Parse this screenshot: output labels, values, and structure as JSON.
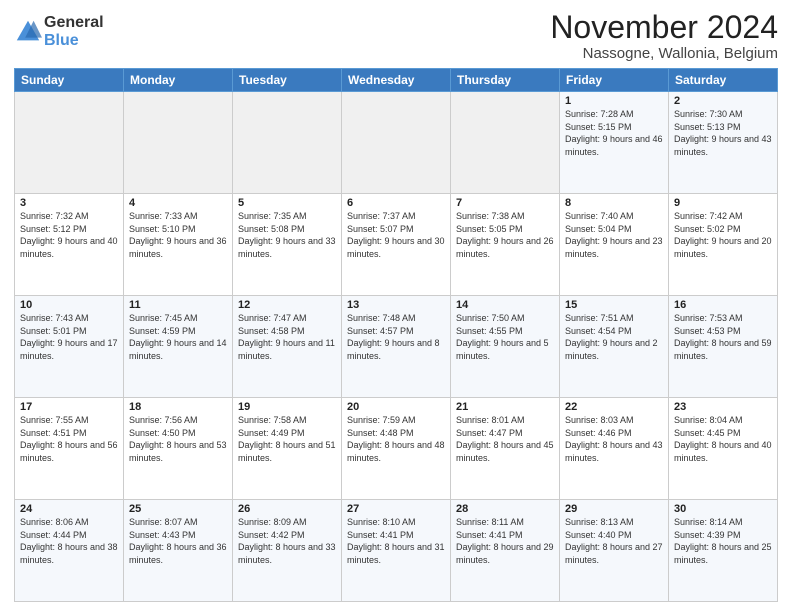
{
  "logo": {
    "general": "General",
    "blue": "Blue"
  },
  "header": {
    "month": "November 2024",
    "location": "Nassogne, Wallonia, Belgium"
  },
  "days_of_week": [
    "Sunday",
    "Monday",
    "Tuesday",
    "Wednesday",
    "Thursday",
    "Friday",
    "Saturday"
  ],
  "weeks": [
    [
      {
        "day": "",
        "info": ""
      },
      {
        "day": "",
        "info": ""
      },
      {
        "day": "",
        "info": ""
      },
      {
        "day": "",
        "info": ""
      },
      {
        "day": "",
        "info": ""
      },
      {
        "day": "1",
        "info": "Sunrise: 7:28 AM\nSunset: 5:15 PM\nDaylight: 9 hours and 46 minutes."
      },
      {
        "day": "2",
        "info": "Sunrise: 7:30 AM\nSunset: 5:13 PM\nDaylight: 9 hours and 43 minutes."
      }
    ],
    [
      {
        "day": "3",
        "info": "Sunrise: 7:32 AM\nSunset: 5:12 PM\nDaylight: 9 hours and 40 minutes."
      },
      {
        "day": "4",
        "info": "Sunrise: 7:33 AM\nSunset: 5:10 PM\nDaylight: 9 hours and 36 minutes."
      },
      {
        "day": "5",
        "info": "Sunrise: 7:35 AM\nSunset: 5:08 PM\nDaylight: 9 hours and 33 minutes."
      },
      {
        "day": "6",
        "info": "Sunrise: 7:37 AM\nSunset: 5:07 PM\nDaylight: 9 hours and 30 minutes."
      },
      {
        "day": "7",
        "info": "Sunrise: 7:38 AM\nSunset: 5:05 PM\nDaylight: 9 hours and 26 minutes."
      },
      {
        "day": "8",
        "info": "Sunrise: 7:40 AM\nSunset: 5:04 PM\nDaylight: 9 hours and 23 minutes."
      },
      {
        "day": "9",
        "info": "Sunrise: 7:42 AM\nSunset: 5:02 PM\nDaylight: 9 hours and 20 minutes."
      }
    ],
    [
      {
        "day": "10",
        "info": "Sunrise: 7:43 AM\nSunset: 5:01 PM\nDaylight: 9 hours and 17 minutes."
      },
      {
        "day": "11",
        "info": "Sunrise: 7:45 AM\nSunset: 4:59 PM\nDaylight: 9 hours and 14 minutes."
      },
      {
        "day": "12",
        "info": "Sunrise: 7:47 AM\nSunset: 4:58 PM\nDaylight: 9 hours and 11 minutes."
      },
      {
        "day": "13",
        "info": "Sunrise: 7:48 AM\nSunset: 4:57 PM\nDaylight: 9 hours and 8 minutes."
      },
      {
        "day": "14",
        "info": "Sunrise: 7:50 AM\nSunset: 4:55 PM\nDaylight: 9 hours and 5 minutes."
      },
      {
        "day": "15",
        "info": "Sunrise: 7:51 AM\nSunset: 4:54 PM\nDaylight: 9 hours and 2 minutes."
      },
      {
        "day": "16",
        "info": "Sunrise: 7:53 AM\nSunset: 4:53 PM\nDaylight: 8 hours and 59 minutes."
      }
    ],
    [
      {
        "day": "17",
        "info": "Sunrise: 7:55 AM\nSunset: 4:51 PM\nDaylight: 8 hours and 56 minutes."
      },
      {
        "day": "18",
        "info": "Sunrise: 7:56 AM\nSunset: 4:50 PM\nDaylight: 8 hours and 53 minutes."
      },
      {
        "day": "19",
        "info": "Sunrise: 7:58 AM\nSunset: 4:49 PM\nDaylight: 8 hours and 51 minutes."
      },
      {
        "day": "20",
        "info": "Sunrise: 7:59 AM\nSunset: 4:48 PM\nDaylight: 8 hours and 48 minutes."
      },
      {
        "day": "21",
        "info": "Sunrise: 8:01 AM\nSunset: 4:47 PM\nDaylight: 8 hours and 45 minutes."
      },
      {
        "day": "22",
        "info": "Sunrise: 8:03 AM\nSunset: 4:46 PM\nDaylight: 8 hours and 43 minutes."
      },
      {
        "day": "23",
        "info": "Sunrise: 8:04 AM\nSunset: 4:45 PM\nDaylight: 8 hours and 40 minutes."
      }
    ],
    [
      {
        "day": "24",
        "info": "Sunrise: 8:06 AM\nSunset: 4:44 PM\nDaylight: 8 hours and 38 minutes."
      },
      {
        "day": "25",
        "info": "Sunrise: 8:07 AM\nSunset: 4:43 PM\nDaylight: 8 hours and 36 minutes."
      },
      {
        "day": "26",
        "info": "Sunrise: 8:09 AM\nSunset: 4:42 PM\nDaylight: 8 hours and 33 minutes."
      },
      {
        "day": "27",
        "info": "Sunrise: 8:10 AM\nSunset: 4:41 PM\nDaylight: 8 hours and 31 minutes."
      },
      {
        "day": "28",
        "info": "Sunrise: 8:11 AM\nSunset: 4:41 PM\nDaylight: 8 hours and 29 minutes."
      },
      {
        "day": "29",
        "info": "Sunrise: 8:13 AM\nSunset: 4:40 PM\nDaylight: 8 hours and 27 minutes."
      },
      {
        "day": "30",
        "info": "Sunrise: 8:14 AM\nSunset: 4:39 PM\nDaylight: 8 hours and 25 minutes."
      }
    ]
  ]
}
